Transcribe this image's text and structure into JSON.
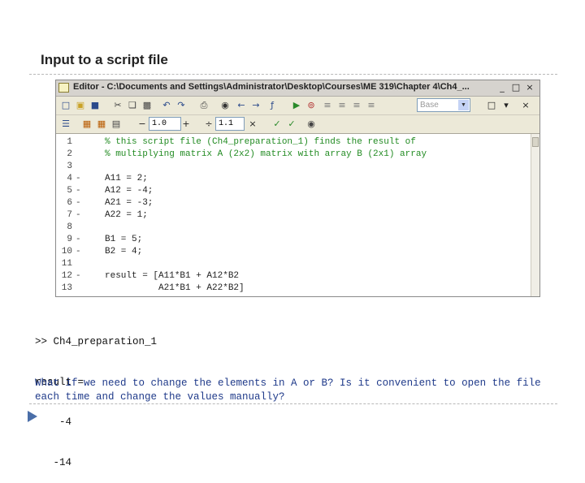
{
  "slide": {
    "title": "Input to a script file"
  },
  "editor": {
    "window_title": "Editor - C:\\Documents and Settings\\Administrator\\Desktop\\Courses\\ME 319\\Chapter 4\\Ch4_...",
    "window_controls": [
      "_",
      "□",
      "×"
    ],
    "toolbar1": {
      "icons": [
        "new-file-icon",
        "open-folder-icon",
        "save-icon",
        "cut-icon",
        "copy-icon",
        "paste-icon",
        "undo-icon",
        "redo-icon",
        "print-icon",
        "find-icon",
        "back-icon",
        "forward-icon",
        "function-icon",
        "run-icon",
        "breakpoint-icon",
        "step-icon",
        "step-in-icon",
        "step-out-icon",
        "continue-icon"
      ],
      "stack_label": "Base",
      "dock_controls": [
        "□",
        "▾",
        "×"
      ]
    },
    "toolbar2": {
      "icons": [
        "cell-icon",
        "eval-cell-icon",
        "eval-advance-icon"
      ],
      "cell_minus": "−",
      "cell_value_1": "1.0",
      "cell_plus": "+",
      "cell_divide": "÷",
      "cell_value_2": "1.1",
      "cell_times": "×",
      "cell_toggle_icons": [
        "publish-cell-icon",
        "cell-mode-icon",
        "help-icon"
      ]
    },
    "code_lines": [
      {
        "num": "1",
        "dash": "",
        "text": "% this script file (Ch4_preparation_1) finds the result of",
        "comment": true
      },
      {
        "num": "2",
        "dash": "",
        "text": "% multiplying matrix A (2x2) matrix with array B (2x1) array",
        "comment": true
      },
      {
        "num": "3",
        "dash": "",
        "text": "",
        "comment": false
      },
      {
        "num": "4",
        "dash": "-",
        "text": "A11 = 2;",
        "comment": false
      },
      {
        "num": "5",
        "dash": "-",
        "text": "A12 = -4;",
        "comment": false
      },
      {
        "num": "6",
        "dash": "-",
        "text": "A21 = -3;",
        "comment": false
      },
      {
        "num": "7",
        "dash": "-",
        "text": "A22 = 1;",
        "comment": false
      },
      {
        "num": "8",
        "dash": "",
        "text": "",
        "comment": false
      },
      {
        "num": "9",
        "dash": "-",
        "text": "B1 = 5;",
        "comment": false
      },
      {
        "num": "10",
        "dash": "-",
        "text": "B2 = 4;",
        "comment": false
      },
      {
        "num": "11",
        "dash": "",
        "text": "",
        "comment": false
      },
      {
        "num": "12",
        "dash": "-",
        "text": "result = [A11*B1 + A12*B2",
        "comment": false
      },
      {
        "num": "13",
        "dash": "",
        "text": "          A21*B1 + A22*B2]",
        "comment": false
      }
    ]
  },
  "console": {
    "lines": [
      ">> Ch4_preparation_1",
      "result =",
      "    -4",
      "   -14"
    ]
  },
  "question": {
    "text": "What if we need to change the elements in A or B? Is it convenient to open the file each time and change the values manually?"
  },
  "colors": {
    "comment": "#228b22",
    "question": "#1f3a8a",
    "nav_arrow": "#4a6ea8"
  }
}
